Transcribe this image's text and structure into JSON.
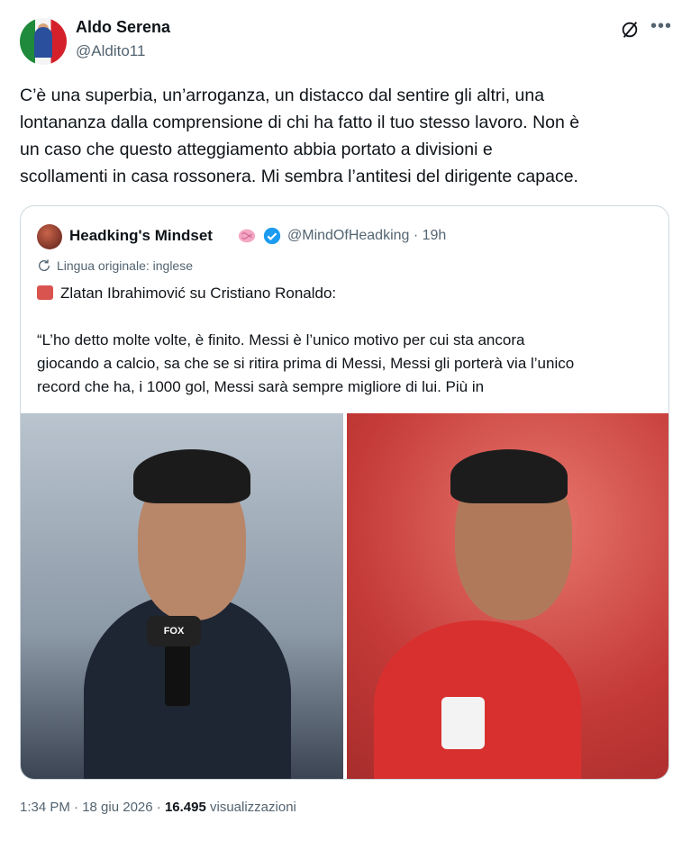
{
  "author": {
    "name": "Aldo Serena",
    "handle": "@Aldito11"
  },
  "tweet": {
    "text": "C’è una superbia, un’arroganza, un distacco dal sentire gli altri, una\nlontananza dalla comprensione di chi ha fatto il tuo stesso lavoro. Non è\nun caso che questo atteggiamento abbia portato a divisioni e\nscollamenti in casa rossonera. Mi sembra l’antitesi del dirigente capace."
  },
  "quote": {
    "name": "Headking's Mindset",
    "handle_time": "@MindOfHeadking · 19h",
    "translation_note": "Lingua originale: inglese",
    "headline": "Zlatan Ibrahimović su Cristiano Ronaldo:",
    "body": "“L’ho detto molte volte, è finito. Messi è l’unico motivo per cui sta ancora\ngiocando a calcio, sa che se si ritira prima di Messi, Messi gli porterà via l’unico\nrecord che ha, i 1000 gol, Messi sarà sempre migliore di lui. Più in",
    "mic_label": "FOX"
  },
  "meta": {
    "time_date": "1:34 PM · 18 giu 2026 · ",
    "views": "16.495",
    "views_label": " visualizzazioni"
  },
  "icons": {
    "grok": "grok-icon",
    "more": "more-icon",
    "brain": "brain-icon",
    "verified": "verified-icon",
    "translate": "translate-icon"
  },
  "colors": {
    "text": "#0f1419",
    "secondary": "#536471",
    "border": "#cfd9de",
    "verified": "#1d9bf0"
  }
}
